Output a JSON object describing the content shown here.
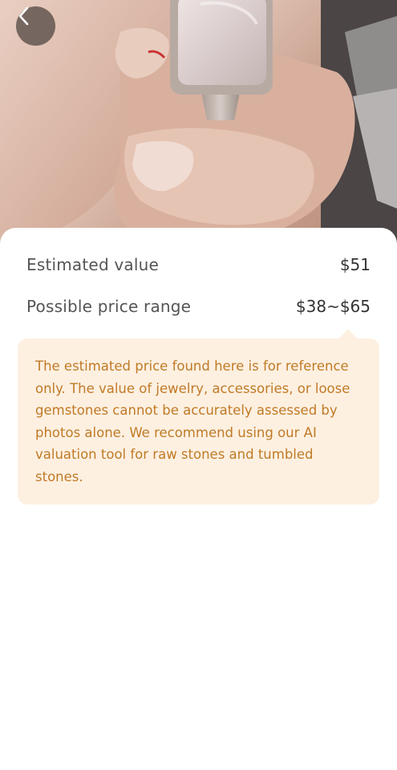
{
  "header": {
    "back_icon": "chevron-left-icon"
  },
  "photo": {
    "subject": "ring-photo"
  },
  "valuation": {
    "estimated_label": "Estimated value",
    "estimated_value": "$51",
    "range_label": "Possible price range",
    "range_value": "$38~$65"
  },
  "notice": {
    "text": "The estimated price found here is for reference only. The value of jewelry, accessories, or loose gemstones cannot be accurately assessed by photos alone. We recommend using our AI valuation tool for raw stones and tumbled stones."
  },
  "colors": {
    "notice_bg": "#fdf0e1",
    "notice_text": "#c07a26",
    "label_text": "#555555"
  }
}
